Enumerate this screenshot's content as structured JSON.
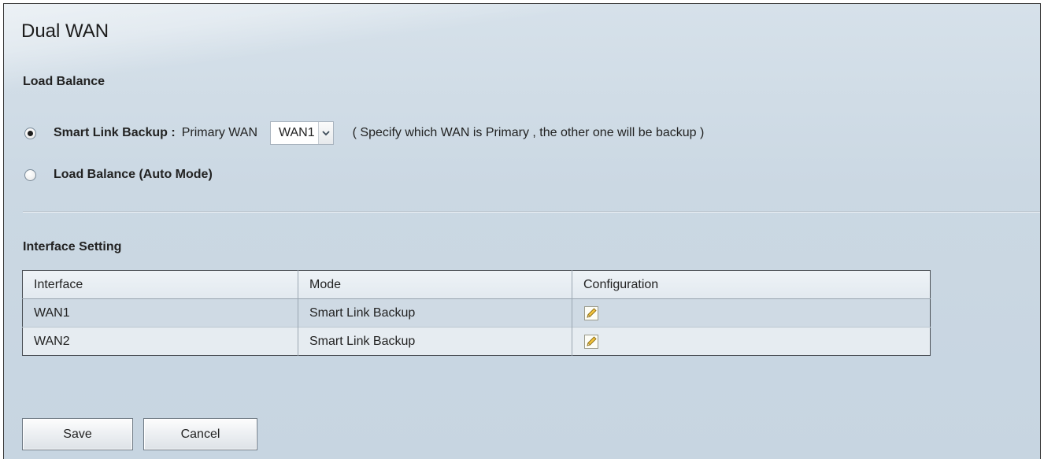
{
  "page": {
    "title": "Dual WAN"
  },
  "load_balance": {
    "section_title": "Load Balance",
    "smart_link": {
      "label": "Smart Link Backup :",
      "selected": true,
      "primary_label": "Primary WAN",
      "primary_select_value": "WAN1",
      "hint": "( Specify which WAN is Primary , the other one will be backup )"
    },
    "auto_mode": {
      "label": "Load Balance (Auto Mode)",
      "selected": false
    }
  },
  "interface_setting": {
    "section_title": "Interface Setting",
    "columns": [
      "Interface",
      "Mode",
      "Configuration"
    ],
    "rows": [
      {
        "interface": "WAN1",
        "mode": "Smart Link Backup",
        "config_icon": "edit-pencil-icon"
      },
      {
        "interface": "WAN2",
        "mode": "Smart Link Backup",
        "config_icon": "edit-pencil-icon"
      }
    ]
  },
  "actions": {
    "save_label": "Save",
    "cancel_label": "Cancel"
  },
  "colors": {
    "background": "#cbd8e3",
    "row_highlight": "#cfdae4",
    "row_alt": "#e6ecf1",
    "edit_icon_fill": "#f3c33c"
  }
}
